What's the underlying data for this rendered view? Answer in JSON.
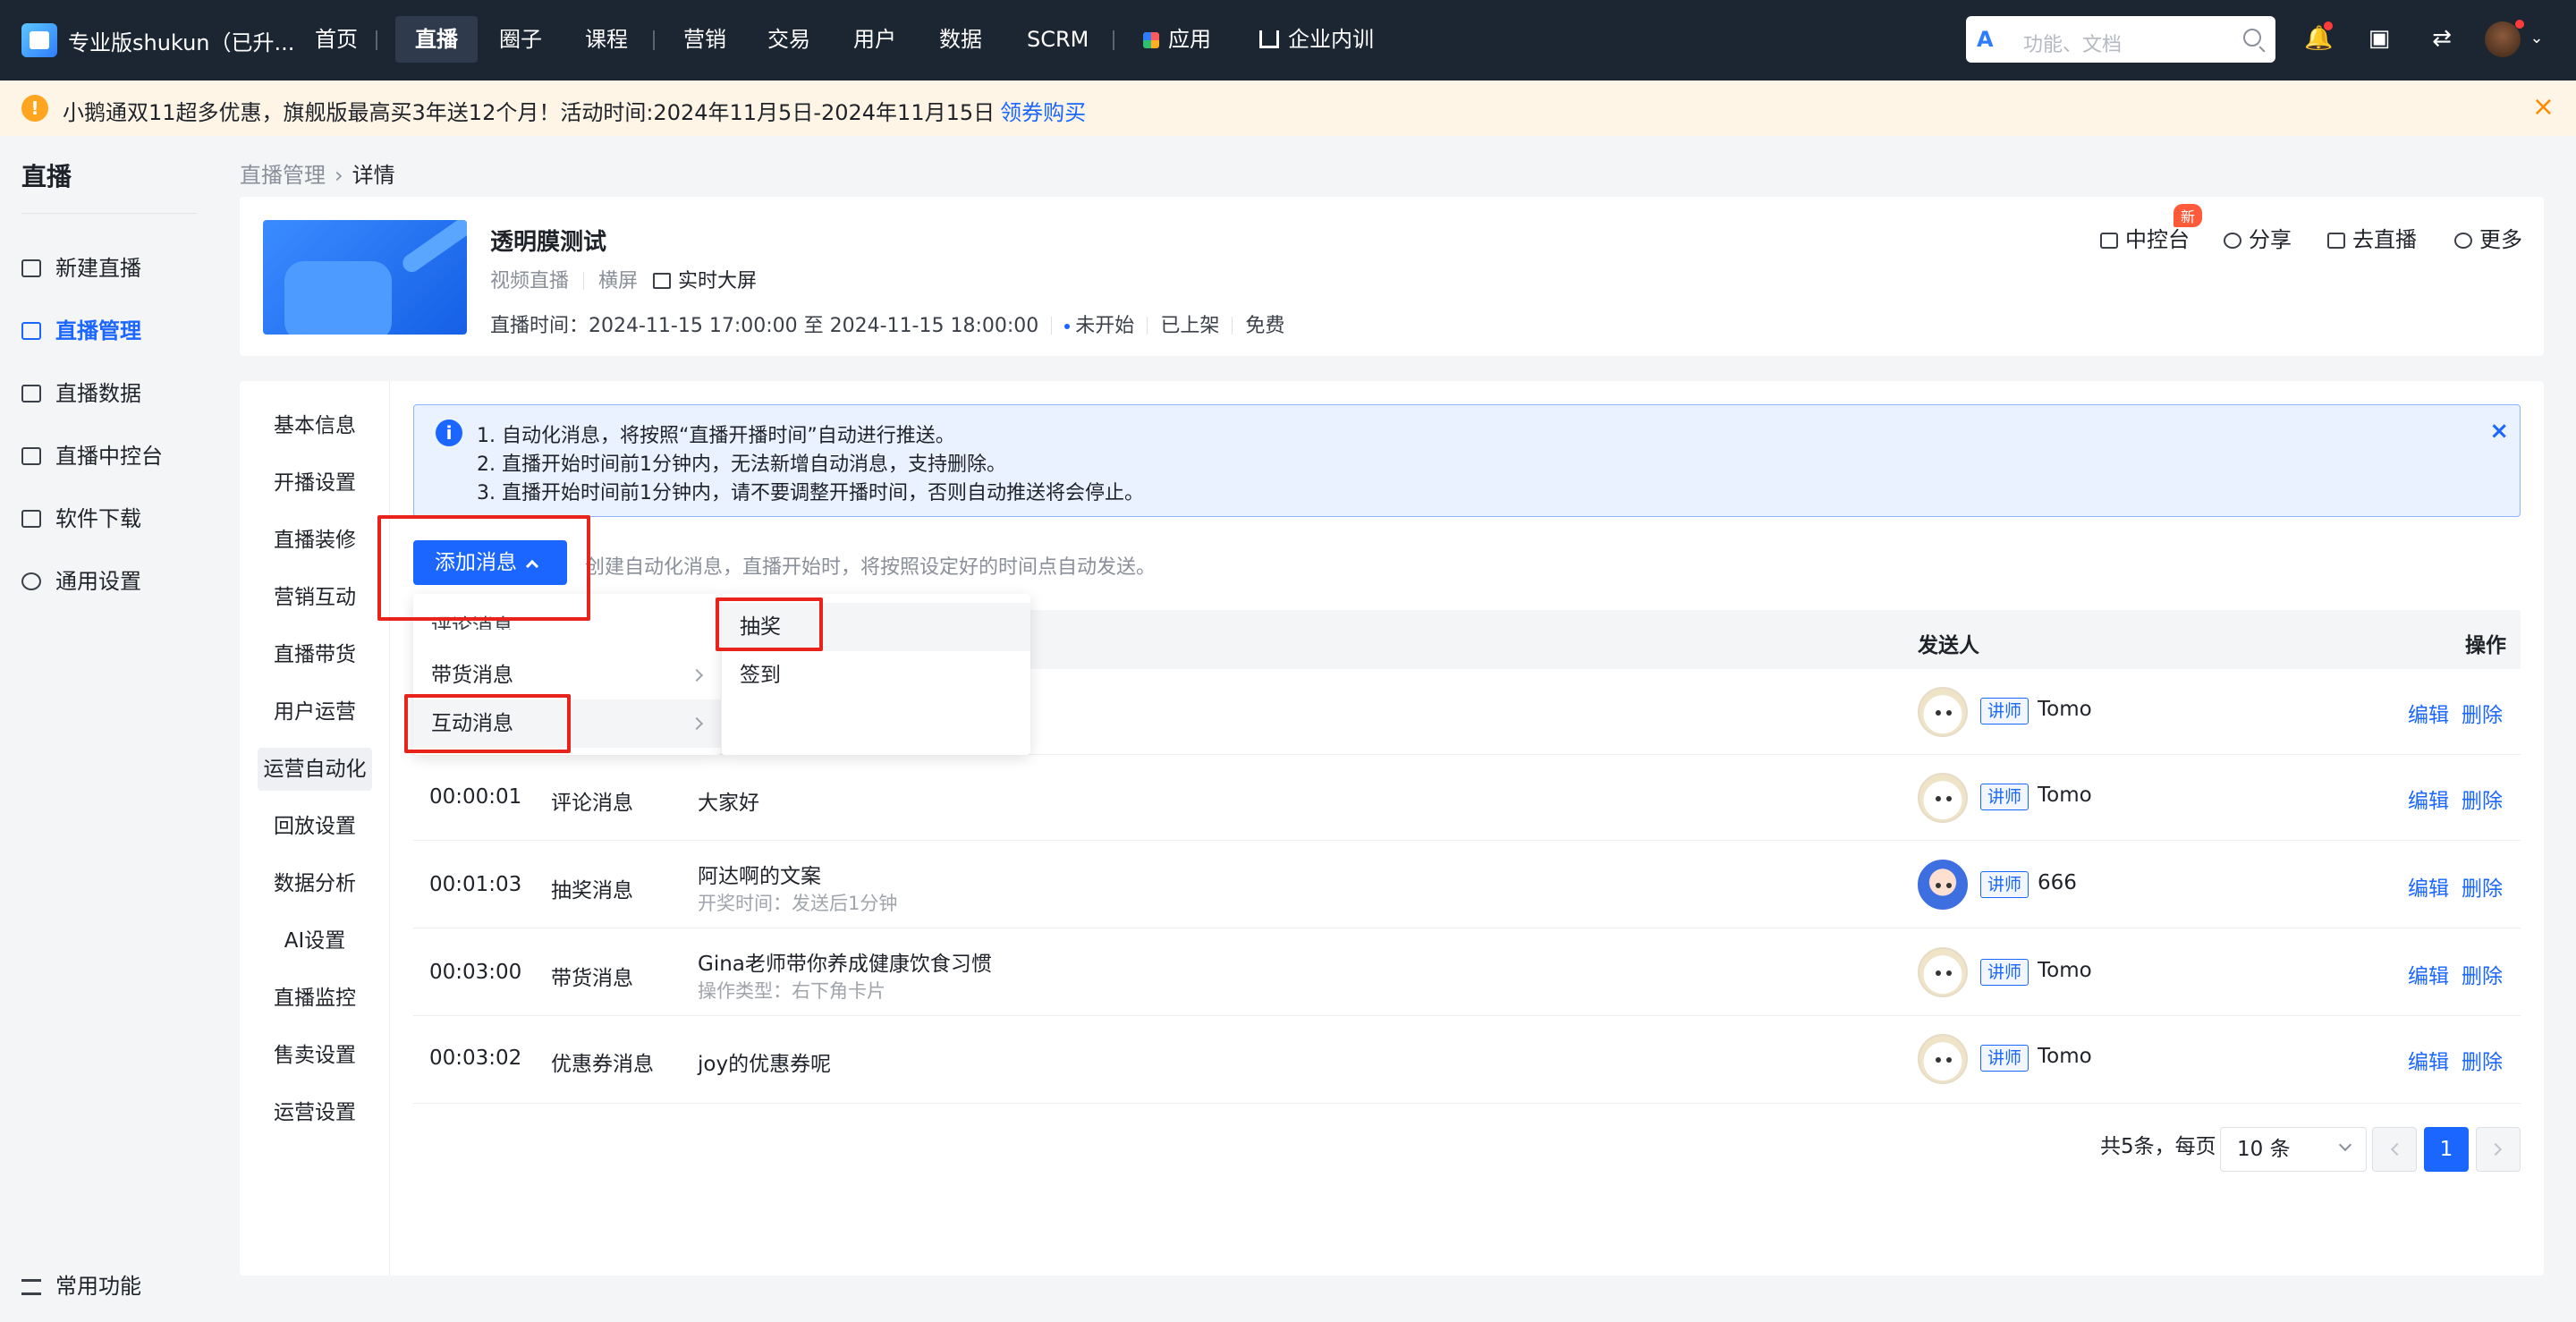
{
  "topbar": {
    "brand": "专业版shukun（已升...",
    "nav": [
      "首页",
      "直播",
      "圈子",
      "课程",
      "营销",
      "交易",
      "用户",
      "数据",
      "SCRM",
      "应用",
      "企业内训"
    ],
    "search_placeholder": "功能、文档"
  },
  "notice": {
    "text": "小鹅通双11超多优惠，旗舰版最高买3年送12个月！活动时间:2024年11月5日-2024年11月15日",
    "link": "领券购买"
  },
  "sidebar": {
    "title": "直播",
    "items": [
      "新建直播",
      "直播管理",
      "直播数据",
      "直播中控台",
      "软件下载",
      "通用设置"
    ],
    "bottom": "常用功能"
  },
  "breadcrumb": {
    "parent": "直播管理",
    "current": "详情"
  },
  "live": {
    "title": "透明膜测试",
    "type": "视频直播",
    "orientation": "横屏",
    "screen": "实时大屏",
    "time": "直播时间：2024-11-15 17:00:00 至 2024-11-15 18:00:00",
    "status": "未开始",
    "shelf": "已上架",
    "price": "免费",
    "actions": [
      "中控台",
      "分享",
      "去直播",
      "更多"
    ],
    "new_badge": "新"
  },
  "tabs": [
    "基本信息",
    "开播设置",
    "直播装修",
    "营销互动",
    "直播带货",
    "用户运营",
    "运营自动化",
    "回放设置",
    "数据分析",
    "AI设置",
    "直播监控",
    "售卖设置",
    "运营设置"
  ],
  "info": {
    "lines": [
      "1. 自动化消息，将按照“直播开播时间”自动进行推送。",
      "2. 直播开始时间前1分钟内，无法新增自动消息，支持删除。",
      "3. 直播开始时间前1分钟内，请不要调整开播时间，否则自动推送将会停止。"
    ]
  },
  "add_button": "添加消息",
  "hint": "创建自动化消息，直播开始时，将按照设定好的时间点自动发送。",
  "menu": {
    "items": [
      "评论消息",
      "带货消息",
      "互动消息"
    ],
    "submenu": [
      "抽奖",
      "签到"
    ]
  },
  "table": {
    "headers": {
      "sender": "发送人",
      "ops": "操作"
    },
    "rows": [
      {
        "time": "",
        "type": "",
        "content": "",
        "sub": "",
        "tag": "讲师",
        "sender": "Tomo",
        "edit": "编辑",
        "del": "删除"
      },
      {
        "time": "00:00:01",
        "type": "评论消息",
        "content": "大家好",
        "sub": "",
        "tag": "讲师",
        "sender": "Tomo",
        "edit": "编辑",
        "del": "删除"
      },
      {
        "time": "00:01:03",
        "type": "抽奖消息",
        "content": "阿达啊的文案",
        "sub": "开奖时间：发送后1分钟",
        "tag": "讲师",
        "sender": "666",
        "edit": "编辑",
        "del": "删除"
      },
      {
        "time": "00:03:00",
        "type": "带货消息",
        "content": "Gina老师带你养成健康饮食习惯",
        "sub": "操作类型：右下角卡片",
        "tag": "讲师",
        "sender": "Tomo",
        "edit": "编辑",
        "del": "删除"
      },
      {
        "time": "00:03:02",
        "type": "优惠券消息",
        "content": "joy的优惠券呢",
        "sub": "",
        "tag": "讲师",
        "sender": "Tomo",
        "edit": "编辑",
        "del": "删除"
      }
    ]
  },
  "pagination": {
    "total": "共5条，每页",
    "size": "10 条",
    "page": "1"
  }
}
